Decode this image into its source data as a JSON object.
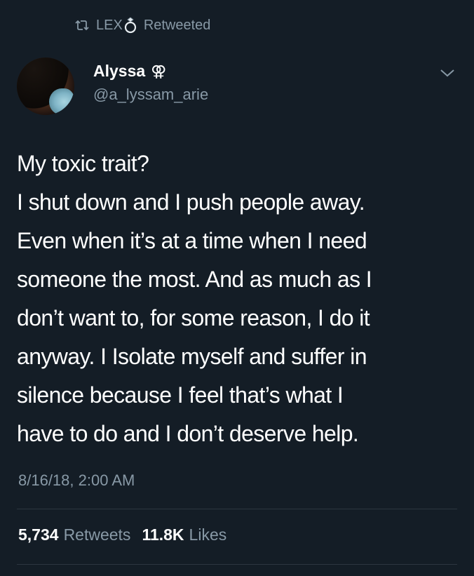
{
  "retweet_banner": {
    "user": "LEX",
    "status": "Retweeted",
    "icons": [
      "retweet-icon",
      "ring-icon"
    ]
  },
  "author": {
    "name": "Alyssa",
    "name_symbol": "⚢",
    "handle": "@a_lyssam_arie"
  },
  "tweet": {
    "lines": [
      "My toxic trait?",
      "I shut down and I push people away.",
      "Even when it’s at a time when I need",
      "someone the most. And as much as I",
      "don’t want to, for some reason, I do it",
      "anyway. I Isolate myself and suffer in",
      "silence because I feel that’s what I",
      "have to do and I don’t deserve help."
    ],
    "timestamp": "8/16/18, 2:00 AM"
  },
  "stats": {
    "retweets_count": "5,734",
    "retweets_label": "Retweets",
    "likes_count": "11.8K",
    "likes_label": "Likes"
  },
  "colors": {
    "background": "#141d26",
    "secondary_text": "#8899a6",
    "primary_text": "#ffffff",
    "divider": "#2c3640"
  }
}
